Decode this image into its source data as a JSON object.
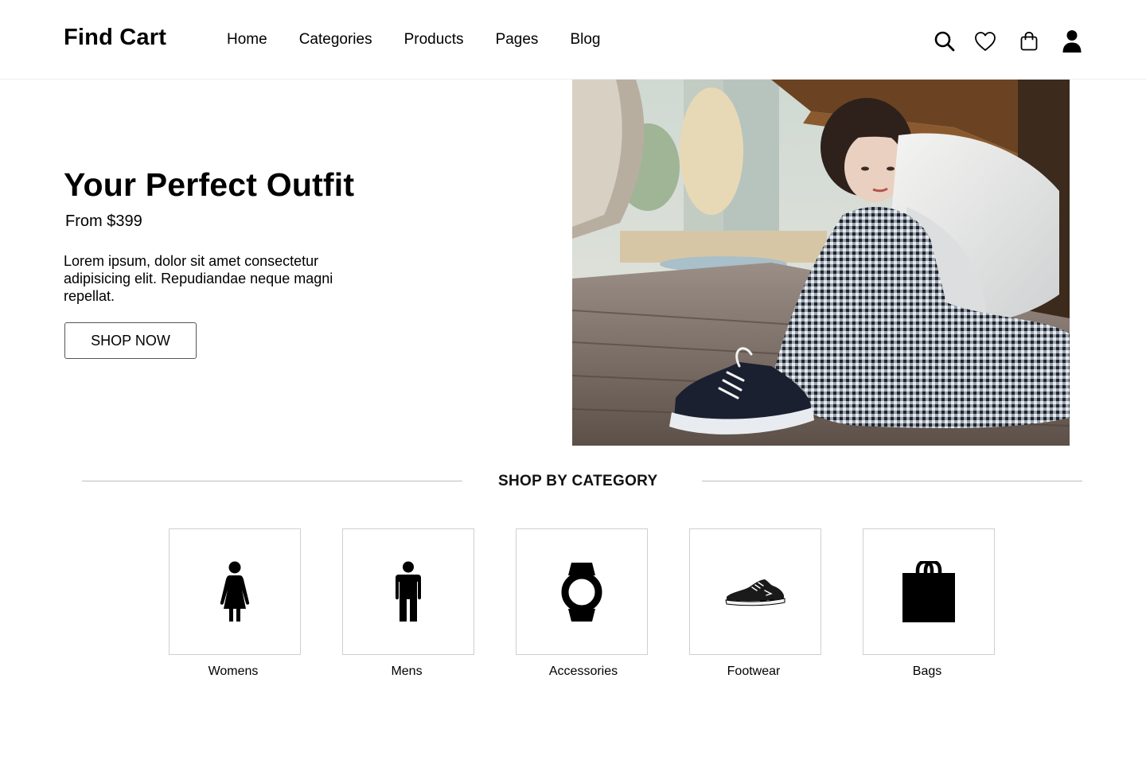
{
  "header": {
    "logo": "Find Cart",
    "nav": [
      {
        "label": "Home"
      },
      {
        "label": "Categories"
      },
      {
        "label": "Products"
      },
      {
        "label": "Pages"
      },
      {
        "label": "Blog"
      }
    ],
    "icons": [
      "search-icon",
      "heart-icon",
      "shopping-bag-icon",
      "user-icon"
    ]
  },
  "hero": {
    "title": "Your Perfect Outfit",
    "price": "From $399",
    "description": "Lorem ipsum, dolor sit amet consectetur adipisicing elit. Repudiandae neque magni repellat.",
    "cta": "SHOP NOW"
  },
  "categories": {
    "heading": "SHOP BY CATEGORY",
    "items": [
      {
        "label": "Womens",
        "icon": "woman-icon"
      },
      {
        "label": "Mens",
        "icon": "man-icon"
      },
      {
        "label": "Accessories",
        "icon": "watch-icon"
      },
      {
        "label": "Footwear",
        "icon": "sneaker-icon"
      },
      {
        "label": "Bags",
        "icon": "bag-icon"
      }
    ]
  },
  "colors": {
    "text": "#000000",
    "border": "#cfcfcf",
    "divider": "#bdbdbd",
    "background": "#ffffff"
  }
}
